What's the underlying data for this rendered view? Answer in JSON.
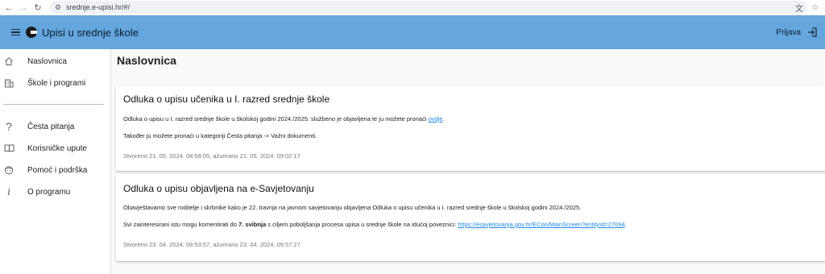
{
  "browser": {
    "url": "srednje.e-upisi.hr/#/"
  },
  "app_bar": {
    "title": "Upisi u srednje škole",
    "login_label": "Prijava"
  },
  "sidebar": {
    "items": [
      {
        "label": "Naslovnica",
        "icon": "home-icon"
      },
      {
        "label": "Škole i programi",
        "icon": "building-icon"
      },
      {
        "label": "Česta pitanja",
        "icon": "question-icon"
      },
      {
        "label": "Korisničke upute",
        "icon": "book-icon"
      },
      {
        "label": "Pomoć i podrška",
        "icon": "face-icon"
      },
      {
        "label": "O programu",
        "icon": "info-icon"
      }
    ]
  },
  "main": {
    "page_title": "Naslovnica",
    "cards": [
      {
        "title": "Odluka o upisu učenika u I. razred srednje škole",
        "p1_text": "Odluka o upisu u I. razred srednje škole u školskoj godini 2024./2025. službeno je objavljena te ju možete pronaći ",
        "p1_link": "ovdje",
        "p1_end": ".",
        "p2_text": "Također ju možete pronaći u kategoriji Česta pitanja -> Važni dokumenti.",
        "meta": "Stvoreno 21. 05. 2024. 08:58:05, ažurirano 21. 05. 2024. 09:02:17"
      },
      {
        "title": "Odluka o upisu objavljena na e-Savjetovanju",
        "p1_text": "Obavještavamo sve roditelje i skrbnike kako je 22. travnja na javnom savjetovanju objavljena Odluka o upisu učenika u I. razred srednje škole u školskoj godini 2024./2025.",
        "p2_pre": "Svi zainteresirani istu mogu komentirati do ",
        "p2_bold": "7. svibnja",
        "p2_mid": " s ciljem poboljšanja procesa upisa u srednje škole na idućoj poveznici: ",
        "p2_link": "https://esavjetovanja.gov.hr/ECon/MainScreen?entityId=27094",
        "p2_end": ".",
        "meta": "Stvoreno 23. 04. 2024. 09:53:57, ažurirano 23. 04. 2024. 09:57:27"
      }
    ]
  },
  "colors": {
    "app_bar": "#64a6dd",
    "link": "#1e88e5"
  }
}
